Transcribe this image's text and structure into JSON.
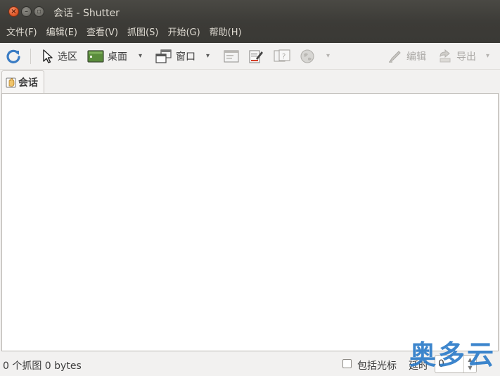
{
  "window": {
    "title": "会话 - Shutter"
  },
  "menubar": {
    "items": [
      {
        "label": "文件(F)"
      },
      {
        "label": "编辑(E)"
      },
      {
        "label": "查看(V)"
      },
      {
        "label": "抓图(S)"
      },
      {
        "label": "开始(G)"
      },
      {
        "label": "帮助(H)"
      }
    ]
  },
  "toolbar": {
    "refresh_icon": "refresh-icon",
    "selection_label": "选区",
    "desktop_label": "桌面",
    "window_label": "窗口",
    "edit_label": "编辑",
    "export_label": "导出",
    "dropdown_glyph": "▾"
  },
  "tabs": [
    {
      "label": "会话"
    }
  ],
  "statusbar": {
    "summary": "0 个抓图  0 bytes",
    "include_cursor_label": "包括光标",
    "include_cursor_checked": false,
    "delay_label": "延时",
    "delay_value": "0"
  },
  "watermark": {
    "text": "奥多云"
  },
  "colors": {
    "titlebar_bg": "#3c3b37",
    "close_button": "#e05a2a",
    "watermark": "#2d7cc9"
  }
}
